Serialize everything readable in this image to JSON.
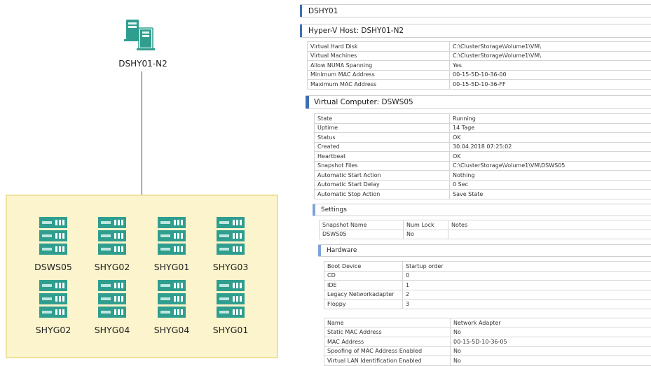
{
  "diagram": {
    "host_label": "DSHY01-N2",
    "host_icon": "server-pair-icon",
    "vm_icon": "rack-server-icon",
    "vms": [
      {
        "label": "DSWS05"
      },
      {
        "label": "SHYG02"
      },
      {
        "label": "SHYG01"
      },
      {
        "label": "SHYG03"
      },
      {
        "label": "SHYG02"
      },
      {
        "label": "SHYG04"
      },
      {
        "label": "SHYG04"
      },
      {
        "label": "SHYG01"
      }
    ],
    "colors": {
      "box_fill": "#fbf4cc",
      "box_border": "#efe29a",
      "server": "#2f9e8f"
    }
  },
  "panel": {
    "cluster_title": "DSHY01",
    "host_title": "Hyper-V Host: DSHY01-N2",
    "host_props": [
      {
        "k": "Virtual Hard Disk",
        "v": "C:\\ClusterStorage\\Volume1\\VM\\"
      },
      {
        "k": "Virtual Machines",
        "v": "C:\\ClusterStorage\\Volume1\\VM\\"
      },
      {
        "k": "Allow NUMA Spanning",
        "v": "Yes"
      },
      {
        "k": "Minimum MAC Address",
        "v": "00-15-5D-10-36-00"
      },
      {
        "k": "Maximum MAC Address",
        "v": "00-15-5D-10-36-FF"
      }
    ],
    "vm_title": "Virtual Computer: DSWS05",
    "vm_props": [
      {
        "k": "State",
        "v": "Running"
      },
      {
        "k": "Uptime",
        "v": "14 Tage"
      },
      {
        "k": "Status",
        "v": "OK"
      },
      {
        "k": "Created",
        "v": "30.04.2018 07:25:02"
      },
      {
        "k": "Heartbeat",
        "v": "OK"
      },
      {
        "k": "Snapshot Files",
        "v": "C:\\ClusterStorage\\Volume1\\VM\\DSWS05"
      },
      {
        "k": "Automatic Start Action",
        "v": "Nothing"
      },
      {
        "k": "Automatic Start Delay",
        "v": "0 Sec"
      },
      {
        "k": "Automatic Stop Action",
        "v": "Save State"
      }
    ],
    "settings_title": "Settings",
    "settings_headers": [
      "Snapshot Name",
      "Num Lock",
      "Notes"
    ],
    "settings_rows": [
      [
        "DSWS05",
        "No",
        ""
      ]
    ],
    "hardware_title": "Hardware",
    "hardware_headers": [
      "Boot Device",
      "Startup order"
    ],
    "hardware_rows": [
      [
        "CD",
        "0"
      ],
      [
        "IDE",
        "1"
      ],
      [
        "Legacy Networkadapter",
        "2"
      ],
      [
        "Floppy",
        "3"
      ]
    ],
    "nic_props": [
      {
        "k": "Name",
        "v": "Network Adapter"
      },
      {
        "k": "Static MAC Address",
        "v": "No"
      },
      {
        "k": "MAC Address",
        "v": "00-15-5D-10-36-05"
      },
      {
        "k": "Spoofing of MAC Address Enabled",
        "v": "No"
      },
      {
        "k": "Virtual LAN Identification Enabled",
        "v": "No"
      }
    ],
    "accent": "#3f6fb4"
  }
}
